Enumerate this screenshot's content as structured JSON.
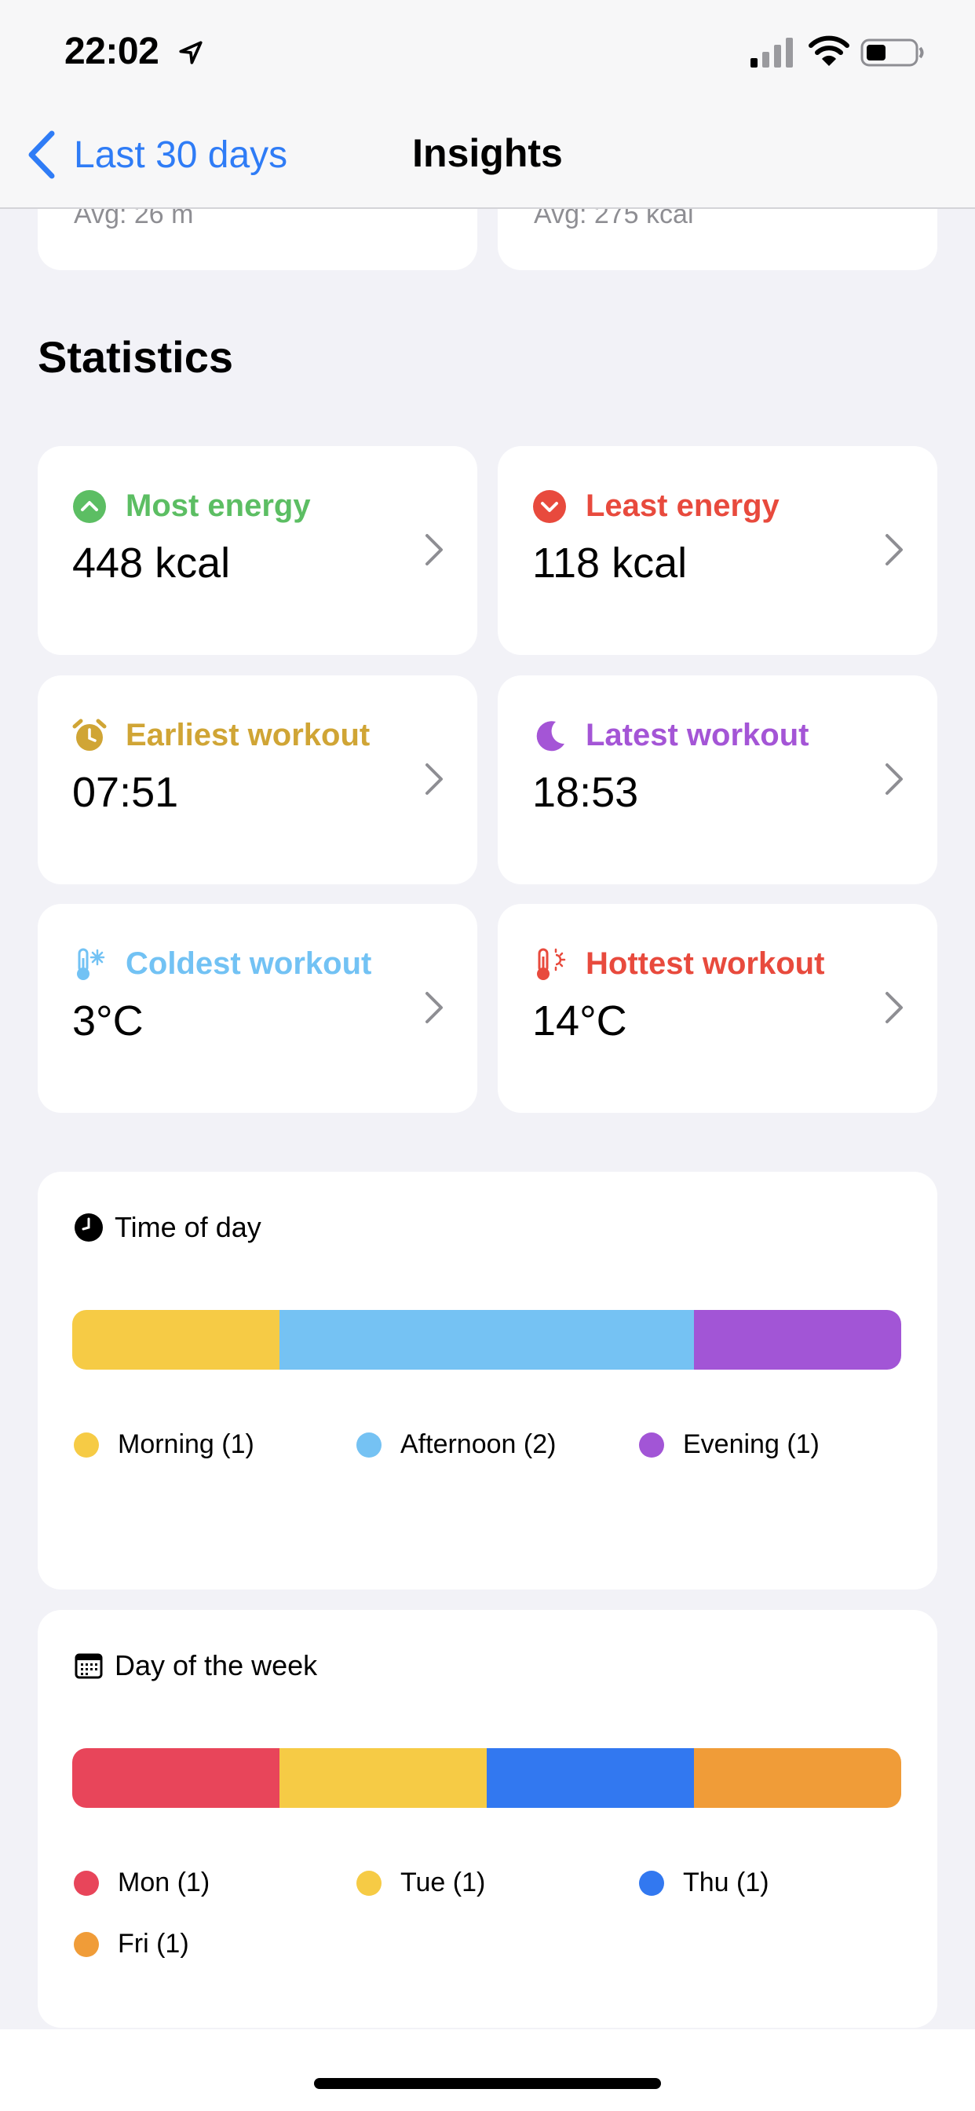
{
  "status_bar": {
    "time": "22:02"
  },
  "nav": {
    "back_label": "Last 30 days",
    "title": "Insights"
  },
  "summary_partial": {
    "left_avg": "Avg: 26 m",
    "right_avg": "Avg: 275 kcal"
  },
  "statistics": {
    "title": "Statistics",
    "cards": [
      {
        "label": "Most energy",
        "value": "448 kcal",
        "color": "#5cbe63",
        "icon": "arrow-up-circle-icon"
      },
      {
        "label": "Least energy",
        "value": "118 kcal",
        "color": "#e84a3d",
        "icon": "arrow-down-circle-icon"
      },
      {
        "label": "Earliest workout",
        "value": "07:51",
        "color": "#d0a535",
        "icon": "alarm-clock-icon"
      },
      {
        "label": "Latest workout",
        "value": "18:53",
        "color": "#a455d6",
        "icon": "moon-icon"
      },
      {
        "label": "Coldest workout",
        "value": "3°C",
        "color": "#72c2f4",
        "icon": "thermometer-snowflake-icon"
      },
      {
        "label": "Hottest workout",
        "value": "14°C",
        "color": "#e84a3d",
        "icon": "thermometer-sun-icon"
      }
    ]
  },
  "time_of_day": {
    "title": "Time of day",
    "icon": "clock-icon",
    "segments": [
      {
        "label": "Morning (1)",
        "count": 1,
        "color": "#f6cb45"
      },
      {
        "label": "Afternoon (2)",
        "count": 2,
        "color": "#75c2f3"
      },
      {
        "label": "Evening (1)",
        "count": 1,
        "color": "#a255d6"
      }
    ]
  },
  "day_of_week": {
    "title": "Day of the week",
    "icon": "calendar-icon",
    "segments": [
      {
        "label": "Mon (1)",
        "count": 1,
        "color": "#e8455a"
      },
      {
        "label": "Tue (1)",
        "count": 1,
        "color": "#f6cb45"
      },
      {
        "label": "Thu (1)",
        "count": 1,
        "color": "#3278f0"
      },
      {
        "label": "Fri (1)",
        "count": 1,
        "color": "#f09c38"
      }
    ]
  }
}
